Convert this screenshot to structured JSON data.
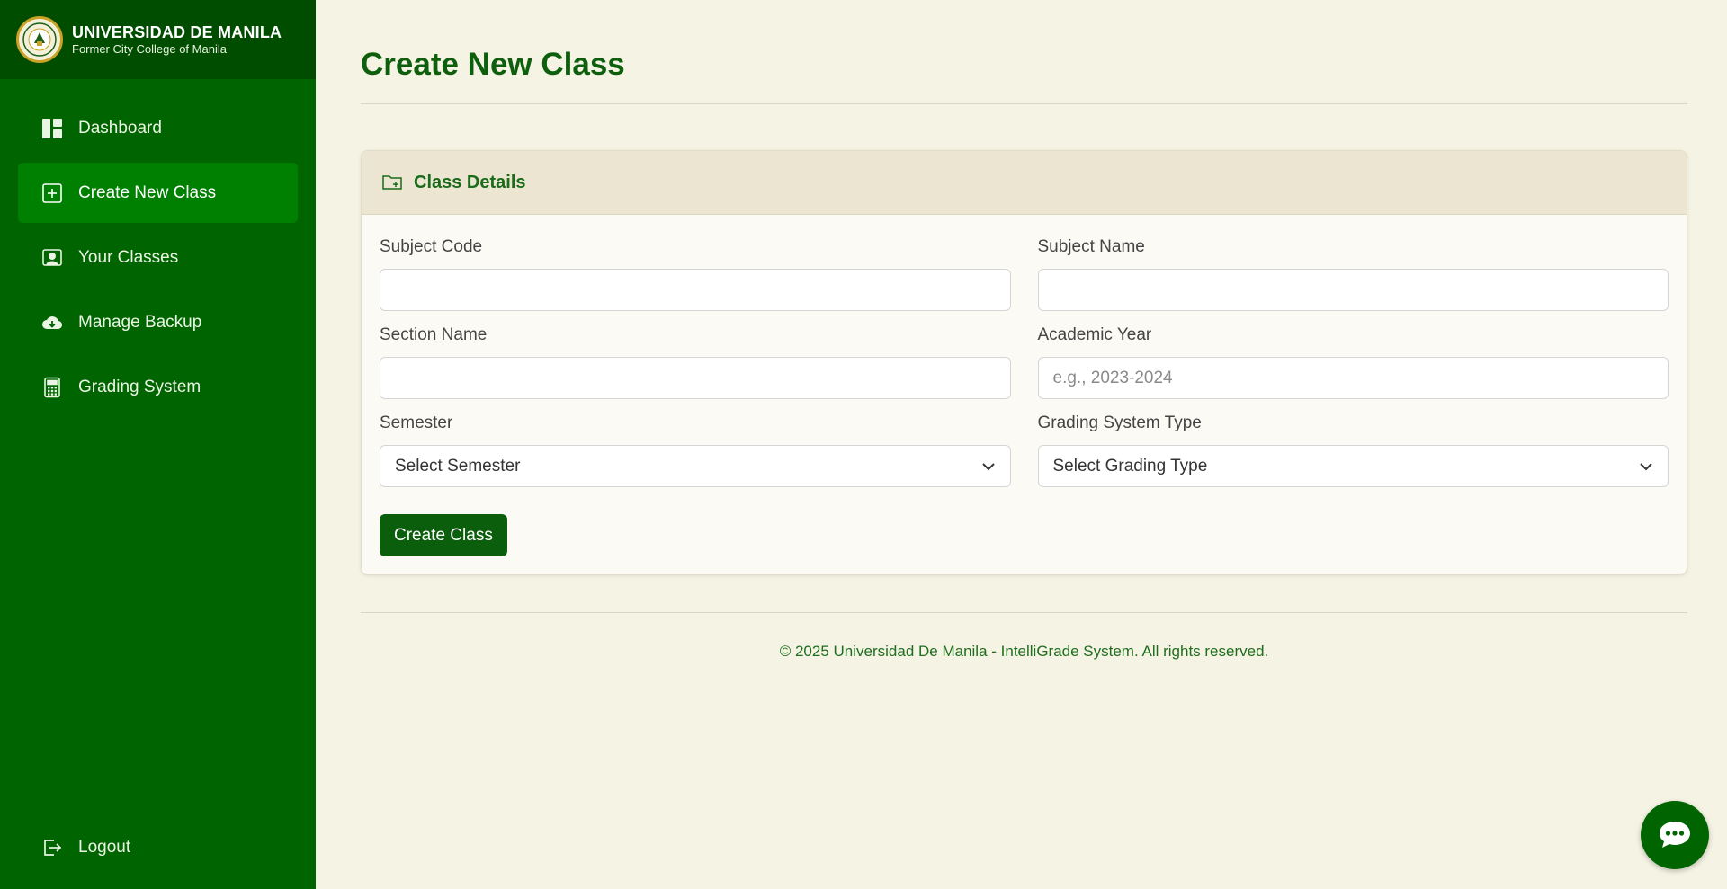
{
  "brand": {
    "title": "UNIVERSIDAD DE MANILA",
    "subtitle": "Former City College of Manila"
  },
  "sidebar": {
    "items": [
      {
        "label": "Dashboard",
        "icon": "dashboard-icon",
        "active": false
      },
      {
        "label": "Create New Class",
        "icon": "plus-square-icon",
        "active": true
      },
      {
        "label": "Your Classes",
        "icon": "person-board-icon",
        "active": false
      },
      {
        "label": "Manage Backup",
        "icon": "cloud-download-icon",
        "active": false
      },
      {
        "label": "Grading System",
        "icon": "calculator-icon",
        "active": false
      }
    ],
    "logout": {
      "label": "Logout",
      "icon": "logout-icon"
    }
  },
  "main": {
    "title": "Create New Class",
    "card": {
      "title": "Class Details",
      "icon": "folder-plus-icon",
      "fields": {
        "subject_code": {
          "label": "Subject Code",
          "value": "",
          "placeholder": ""
        },
        "subject_name": {
          "label": "Subject Name",
          "value": "",
          "placeholder": ""
        },
        "section_name": {
          "label": "Section Name",
          "value": "",
          "placeholder": ""
        },
        "academic_year": {
          "label": "Academic Year",
          "value": "",
          "placeholder": "e.g., 2023-2024"
        },
        "semester": {
          "label": "Semester",
          "selected": "Select Semester"
        },
        "grading_type": {
          "label": "Grading System Type",
          "selected": "Select Grading Type"
        }
      },
      "submit_label": "Create Class"
    },
    "footer": "© 2025 Universidad De Manila - IntelliGrade System. All rights reserved."
  },
  "chat": {
    "icon": "chat-bubble-icon"
  },
  "colors": {
    "sidebar": "#006400",
    "sidebar_active": "#008000",
    "accent": "#0b5e0b",
    "background": "#f5f3e3"
  }
}
